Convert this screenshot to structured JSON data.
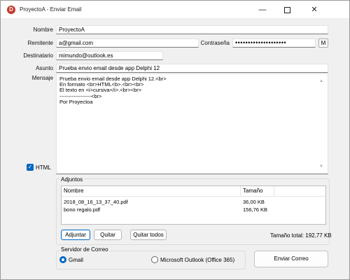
{
  "window": {
    "title": "ProyectoA - Enviar Email",
    "app_icon_letter": "D",
    "controls": {
      "minimize": "—",
      "maximize": "",
      "close": "✕"
    }
  },
  "form": {
    "nombre_label": "Nombre",
    "nombre_value": "ProyectoA",
    "remitente_label": "Remitente",
    "remitente_value": "a@gmail.com",
    "contrasena_label": "Contraseña",
    "contrasena_value": "••••••••••••••••••••",
    "m_button": "M",
    "destinatario_label": "Destinatario",
    "destinatario_value": "mimundo@outlook.es",
    "asunto_label": "Asunto",
    "asunto_value": "Prueba envio email desde app Delphi 12",
    "mensaje_label": "Mensaje",
    "mensaje_lines": [
      "Prueba envio email desde app Delphi 12.<br>",
      "En formato <br>HTML<b>.<br><br>",
      "El texto en <i>cursiva</i>.<br><br>",
      "------------------<br>",
      "Por Proyectoa"
    ],
    "html_checkbox_label": "HTML",
    "html_checked": true
  },
  "adjuntos": {
    "group_title": "Adjuntos",
    "columns": [
      "Nombre",
      "Tamaño"
    ],
    "rows": [
      {
        "nombre": "2018_08_16_13_37_40.pdf",
        "tamano": "36,00 KB"
      },
      {
        "nombre": "bono regalo.pdf",
        "tamano": "156,76 KB"
      }
    ],
    "adjuntar_button": "Adjuntar",
    "quitar_button": "Quitar",
    "quitar_todos_button": "Quitar todos",
    "total_text": "Tamaño total: 192,77 KB"
  },
  "servidor": {
    "group_title": "Servidor de Correo",
    "options": [
      "Gmail",
      "Microsoft Outlook (Office 365)"
    ],
    "selected": "Gmail"
  },
  "enviar_button": "Enviar Correo",
  "colors": {
    "accent": "#0067c0",
    "app_icon": "#c0392b"
  }
}
